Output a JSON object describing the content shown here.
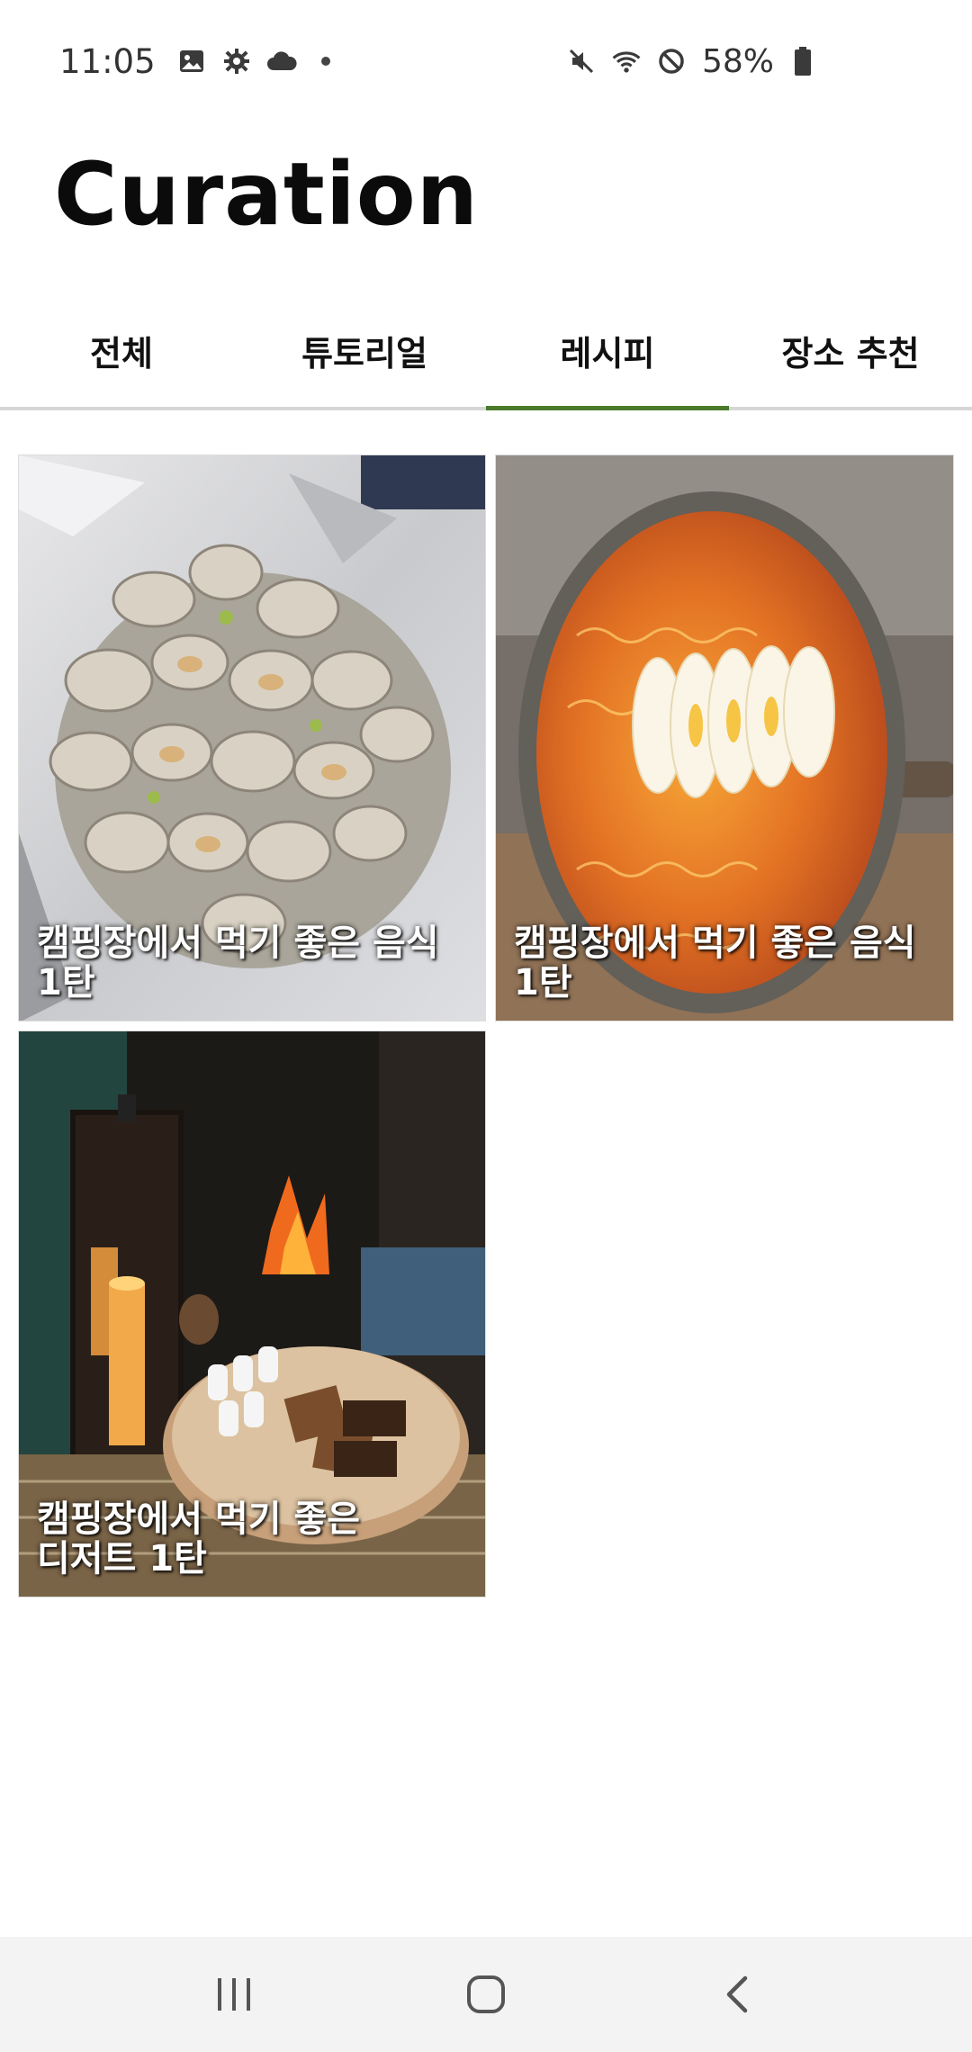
{
  "status_bar": {
    "time": "11:05",
    "left_icons": [
      "gallery-icon",
      "settings-icon",
      "cloud-icon",
      "dot"
    ],
    "right_icons": [
      "mute-icon",
      "wifi-icon",
      "do-not-disturb-icon"
    ],
    "battery_percent": "58%"
  },
  "page": {
    "title": "Curation"
  },
  "tabs": [
    {
      "label": "전체",
      "active": false
    },
    {
      "label": "튜토리얼",
      "active": false
    },
    {
      "label": "레시피",
      "active": true
    },
    {
      "label": "장소 추천",
      "active": false
    }
  ],
  "accent_color": "#4b7a2a",
  "cards": [
    {
      "caption": "캠핑장에서 먹기 좋은 음식 1탄",
      "image": "clams-on-foil"
    },
    {
      "caption": "캠핑장에서 먹기 좋은 음식 1탄",
      "image": "ramen-pan-with-egg"
    },
    {
      "caption": "캠핑장에서 먹기 좋은 디저트 1탄",
      "image": "campfire-smores-lantern"
    }
  ],
  "nav_bar": [
    "recent-apps-icon",
    "home-icon",
    "back-icon"
  ]
}
